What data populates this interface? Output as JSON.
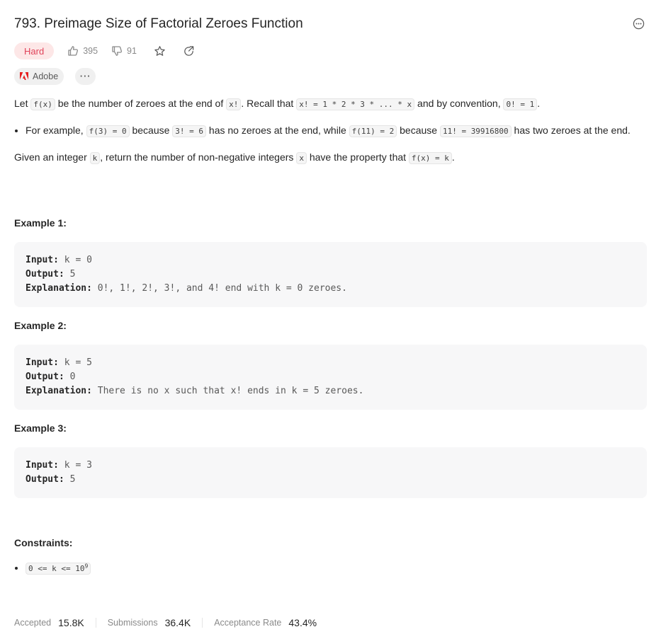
{
  "problem": {
    "title": "793. Preimage Size of Factorial Zeroes Function",
    "difficulty": "Hard",
    "likes": "395",
    "dislikes": "91",
    "tags": [
      "Adobe"
    ],
    "tag_more": "···"
  },
  "description": {
    "p1_a": "Let ",
    "p1_code1": "f(x)",
    "p1_b": " be the number of zeroes at the end of ",
    "p1_code2": "x!",
    "p1_c": ". Recall that ",
    "p1_code3": "x! = 1 * 2 * 3 * ... * x",
    "p1_d": " and by convention, ",
    "p1_code4": "0! = 1",
    "p1_e": ".",
    "bullet_a": "For example, ",
    "bullet_code1": "f(3) = 0",
    "bullet_b": " because ",
    "bullet_code2": "3! = 6",
    "bullet_c": " has no zeroes at the end, while ",
    "bullet_code3": "f(11) = 2",
    "bullet_d": " because ",
    "bullet_code4": "11! = 39916800",
    "bullet_e": " has two zeroes at the end.",
    "p2_a": "Given an integer ",
    "p2_code1": "k",
    "p2_b": ", return the number of non-negative integers ",
    "p2_code2": "x",
    "p2_c": " have the property that ",
    "p2_code3": "f(x) = k",
    "p2_d": "."
  },
  "examples": [
    {
      "title": "Example 1:",
      "input_label": "Input:",
      "input": "k = 0",
      "output_label": "Output:",
      "output": "5",
      "explanation_label": "Explanation:",
      "explanation": "0!, 1!, 2!, 3!, and 4! end with k = 0 zeroes."
    },
    {
      "title": "Example 2:",
      "input_label": "Input:",
      "input": "k = 5",
      "output_label": "Output:",
      "output": "0",
      "explanation_label": "Explanation:",
      "explanation": "There is no x such that x! ends in k = 5 zeroes."
    },
    {
      "title": "Example 3:",
      "input_label": "Input:",
      "input": "k = 3",
      "output_label": "Output:",
      "output": "5"
    }
  ],
  "constraints": {
    "title": "Constraints:",
    "item_base": "0 <= k <= 10",
    "item_exp": "9"
  },
  "stats": {
    "accepted_label": "Accepted",
    "accepted": "15.8K",
    "submissions_label": "Submissions",
    "submissions": "36.4K",
    "rate_label": "Acceptance Rate",
    "rate": "43.4%"
  },
  "colors": {
    "hard_badge_bg": "#fde7e7",
    "hard_badge_text": "#e0435a",
    "adobe_red": "#e61e1e"
  },
  "icons": {
    "more": "more-circle-icon",
    "like": "thumbs-up-icon",
    "dislike": "thumbs-down-icon",
    "star": "star-icon",
    "share": "share-icon",
    "adobe": "adobe-logo-icon"
  }
}
